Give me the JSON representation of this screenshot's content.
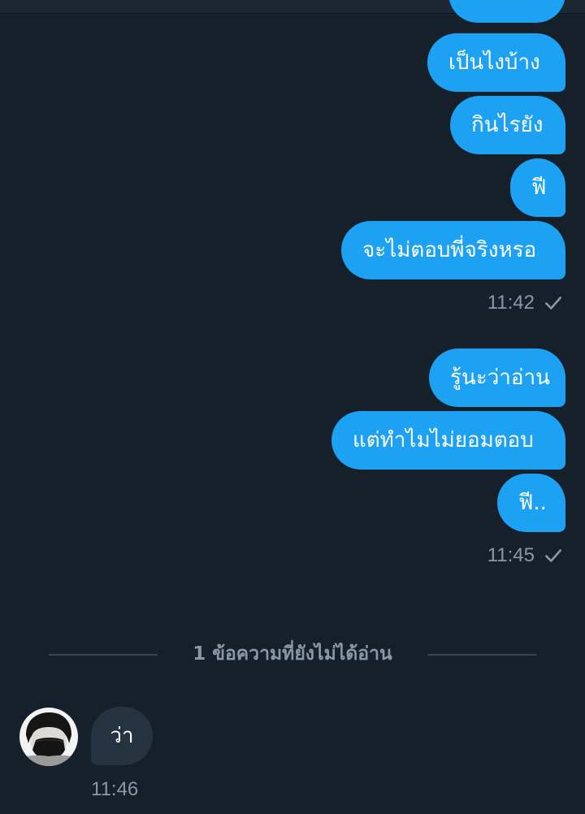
{
  "colors": {
    "background": "#15202b",
    "outgoing_bubble": "#1da1f2",
    "incoming_bubble": "#253341",
    "meta_text": "#8899a6"
  },
  "outgoing_group_1": {
    "messages": [
      "เป็นไงบ้าง",
      "กินไรยัง",
      "ฟี",
      "จะไม่ตอบพี่จริงหรอ"
    ],
    "time": "11:42",
    "status_icon": "check-icon"
  },
  "outgoing_group_2": {
    "messages": [
      "รู้นะว่าอ่าน",
      "แต่ทำไมไม่ยอมตอบ",
      "ฟี.."
    ],
    "time": "11:45",
    "status_icon": "check-icon"
  },
  "unread_divider": {
    "label": "1 ข้อความที่ยังไม่ได้อ่าน"
  },
  "incoming": {
    "avatar_icon": "avatar-icon",
    "message": "ว่า",
    "time": "11:46"
  }
}
